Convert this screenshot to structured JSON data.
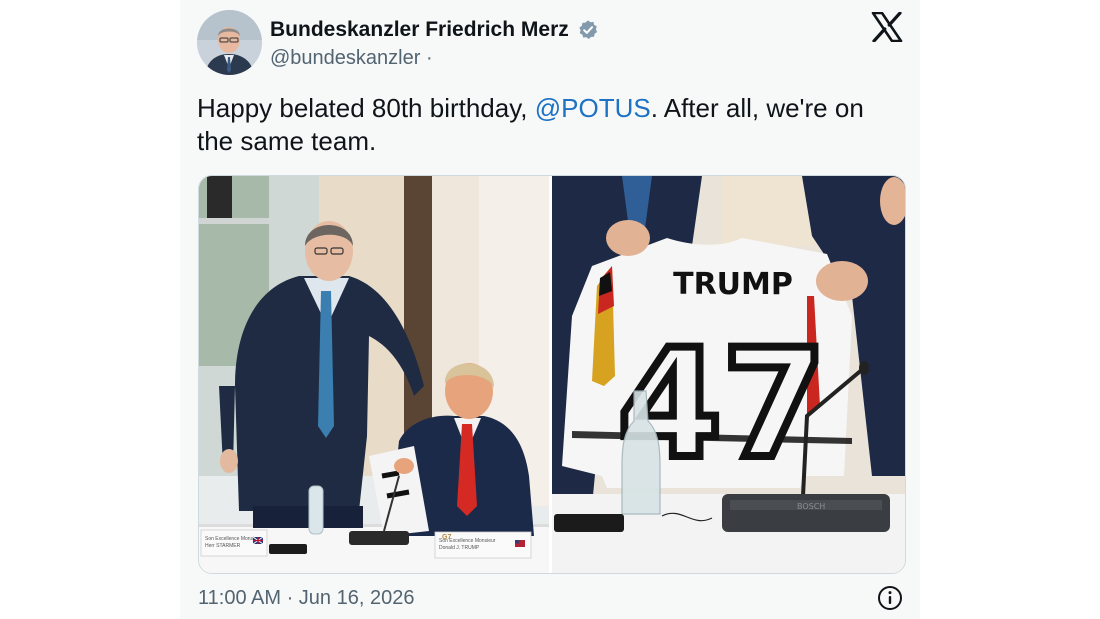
{
  "author": {
    "display_name": "Bundeskanzler Friedrich Merz",
    "handle": "@bundeskanzler",
    "handle_separator": "·",
    "verified": true,
    "verified_color": "#829aab"
  },
  "tweet": {
    "text_before": "Happy belated 80th birthday, ",
    "mention": "@POTUS",
    "text_after": ". After all, we're on the same team.",
    "mention_color": "#1d72c4"
  },
  "media": {
    "left_photo": {
      "placecard_left_line1": "Son Excellence Monsieur",
      "placecard_left_line2": "Herr STARMER",
      "placecard_right_line1": "Son Excellence Monsieur",
      "placecard_right_line2": "Donald J. TRUMP",
      "g7_label": "G7"
    },
    "right_photo": {
      "jersey_name": "TRUMP",
      "jersey_number": "47",
      "mic_brand": "BOSCH"
    }
  },
  "footer": {
    "timestamp": "11:00 AM · Jun 16, 2026"
  },
  "icons": {
    "verified": "verified-badge-icon",
    "platform": "x-logo-icon",
    "info": "info-icon"
  }
}
